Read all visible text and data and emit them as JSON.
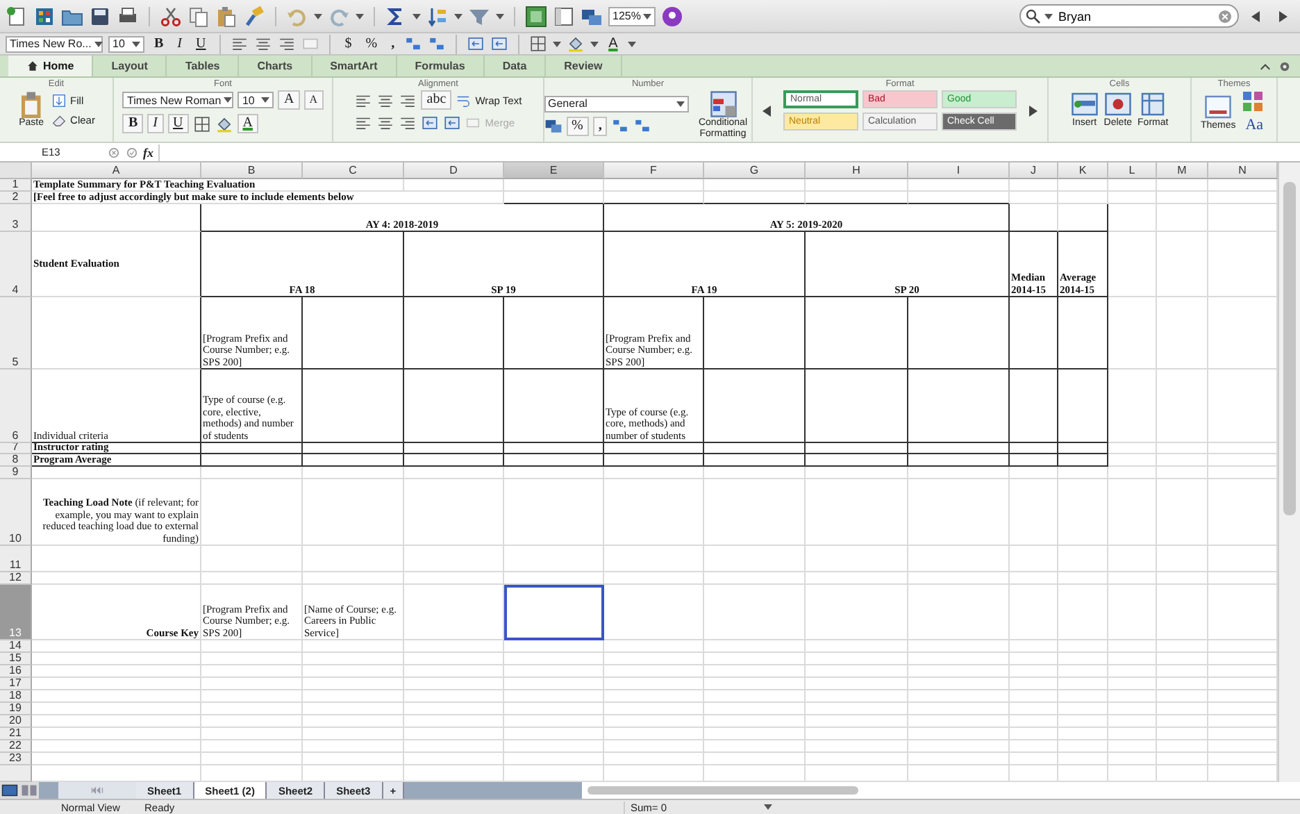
{
  "toolbar": {
    "zoom": "125%",
    "search": {
      "value": "Bryan"
    }
  },
  "format_bar": {
    "font": "Times New Ro...",
    "size": "10",
    "bold": "B",
    "italic": "I",
    "underline": "U",
    "currency": "$",
    "percent": "%",
    "comma": ",",
    "font_color": "A"
  },
  "ribbon": {
    "tabs": [
      {
        "label": "Home",
        "selected": true
      },
      {
        "label": "Layout",
        "selected": false
      },
      {
        "label": "Tables",
        "selected": false
      },
      {
        "label": "Charts",
        "selected": false
      },
      {
        "label": "SmartArt",
        "selected": false
      },
      {
        "label": "Formulas",
        "selected": false
      },
      {
        "label": "Data",
        "selected": false
      },
      {
        "label": "Review",
        "selected": false
      }
    ],
    "edit": {
      "title": "Edit",
      "fill": "Fill",
      "clear": "Clear",
      "paste": "Paste"
    },
    "font": {
      "title": "Font",
      "font": "Times New Roman",
      "size": "10",
      "grow": "A",
      "shrink": "A",
      "bold": "B",
      "italic": "I",
      "underline": "U",
      "font_color": "A"
    },
    "alignment": {
      "title": "Alignment",
      "orientation": "abc",
      "wrap": "Wrap Text",
      "merge": {
        "label": "Merge",
        "disabled": true
      }
    },
    "number": {
      "title": "Number",
      "format": "General",
      "percent": "%",
      "comma": ",",
      "conditional": "Conditional Formatting"
    },
    "format": {
      "title": "Format",
      "styles": [
        {
          "label": "Normal",
          "color": "#ffffff",
          "selected": true
        },
        {
          "label": "Bad",
          "color": "#f8c7ce",
          "selected": false
        },
        {
          "label": "Good",
          "color": "#c8eecf",
          "selected": false
        },
        {
          "label": "Neutral",
          "color": "#fde9a2",
          "selected": false
        },
        {
          "label": "Calculation",
          "color": "#f2f2f2",
          "selected": false
        },
        {
          "label": "Check Cell",
          "color": "#6b6b6b",
          "selected": false
        }
      ]
    },
    "cells": {
      "title": "Cells",
      "insert": "Insert",
      "delete": "Delete",
      "format": "Format"
    },
    "themes": {
      "title": "Themes",
      "themes": "Themes",
      "fonts": "Aa"
    }
  },
  "formula_bar": {
    "name_box": "E13",
    "fx": "fx"
  },
  "sheet": {
    "columns": [
      {
        "label": "A",
        "selected": false
      },
      {
        "label": "B",
        "selected": false
      },
      {
        "label": "C",
        "selected": false
      },
      {
        "label": "D",
        "selected": false
      },
      {
        "label": "E",
        "selected": true
      },
      {
        "label": "F",
        "selected": false
      },
      {
        "label": "G",
        "selected": false
      },
      {
        "label": "H",
        "selected": false
      },
      {
        "label": "I",
        "selected": false
      },
      {
        "label": "J",
        "selected": false
      },
      {
        "label": "K",
        "selected": false
      },
      {
        "label": "L",
        "selected": false
      },
      {
        "label": "M",
        "selected": false
      },
      {
        "label": "N",
        "selected": false
      }
    ],
    "rows": [
      {
        "label": "1",
        "selected": false,
        "cells": [
          {
            "text": "Template Summary for P&T Teaching Evaluation",
            "bold": true
          }
        ]
      },
      {
        "label": "2",
        "selected": false,
        "cells": [
          {
            "text": "[Feel free to adjust accordingly but make sure to include elements below",
            "bold": true
          }
        ]
      },
      {
        "label": "3",
        "selected": false,
        "cells": [
          {
            "text": "AY 4: 2018-2019",
            "bold": true
          },
          {
            "text": "AY 5: 2019-2020",
            "bold": true
          }
        ]
      },
      {
        "label": "4",
        "selected": false,
        "cells": [
          {
            "text": "Student Evaluation",
            "bold": true
          },
          {
            "text": "FA 18",
            "bold": true
          },
          {
            "text": "SP 19",
            "bold": true
          },
          {
            "text": "FA 19",
            "bold": true
          },
          {
            "text": "SP 20",
            "bold": true
          },
          {
            "text": "Median 2014-15",
            "bold": true
          },
          {
            "text": "Average 2014-15",
            "bold": true
          }
        ]
      },
      {
        "label": "5",
        "selected": false,
        "cells": [
          {
            "text": "[Program Prefix and Course Number; e.g. SPS 200]",
            "bold": false
          },
          {
            "text": "[Program Prefix and Course Number; e.g. SPS 200]",
            "bold": false
          }
        ]
      },
      {
        "label": "6",
        "selected": false,
        "cells": [
          {
            "text": "Individual criteria",
            "bold": false
          },
          {
            "text": "Type of course (e.g. core, elective, methods) and number of students",
            "bold": false
          },
          {
            "text": "Type of course (e.g. core, methods) and number of students",
            "bold": false
          }
        ]
      },
      {
        "label": "7",
        "selected": false,
        "cells": [
          {
            "text": "Instructor rating",
            "bold": true
          }
        ]
      },
      {
        "label": "8",
        "selected": false,
        "cells": [
          {
            "text": "Program Average",
            "bold": true
          }
        ]
      },
      {
        "label": "9",
        "selected": false
      },
      {
        "label": "10",
        "selected": false,
        "cells": [
          {
            "text": "**Teaching Load Note** (if relevant; for example, you may want to explain reduced teaching load due to external funding)",
            "bold": false
          }
        ]
      },
      {
        "label": "11",
        "selected": false
      },
      {
        "label": "12",
        "selected": false
      },
      {
        "label": "13",
        "selected": true,
        "cells": [
          {
            "text": "Course Key",
            "bold": true
          },
          {
            "text": "[Program Prefix and Course Number; e.g. SPS 200]",
            "bold": false
          },
          {
            "text": "[Name of Course; e.g. Careers in Public Service]",
            "bold": false
          }
        ]
      },
      {
        "label": "14",
        "selected": false
      },
      {
        "label": "15",
        "selected": false
      },
      {
        "label": "16",
        "selected": false
      },
      {
        "label": "17",
        "selected": false
      },
      {
        "label": "18",
        "selected": false
      },
      {
        "label": "19",
        "selected": false
      },
      {
        "label": "20",
        "selected": false
      },
      {
        "label": "21",
        "selected": false
      },
      {
        "label": "22",
        "selected": false
      },
      {
        "label": "23",
        "selected": false
      }
    ]
  },
  "sheet_tabs": [
    {
      "label": "Sheet1",
      "selected": false
    },
    {
      "label": "Sheet1 (2)",
      "selected": true
    },
    {
      "label": "Sheet2",
      "selected": false
    },
    {
      "label": "Sheet3",
      "selected": false
    }
  ],
  "add_sheet": "+",
  "status_bar": {
    "view": "Normal View",
    "status": "Ready",
    "sum": "Sum= 0"
  }
}
